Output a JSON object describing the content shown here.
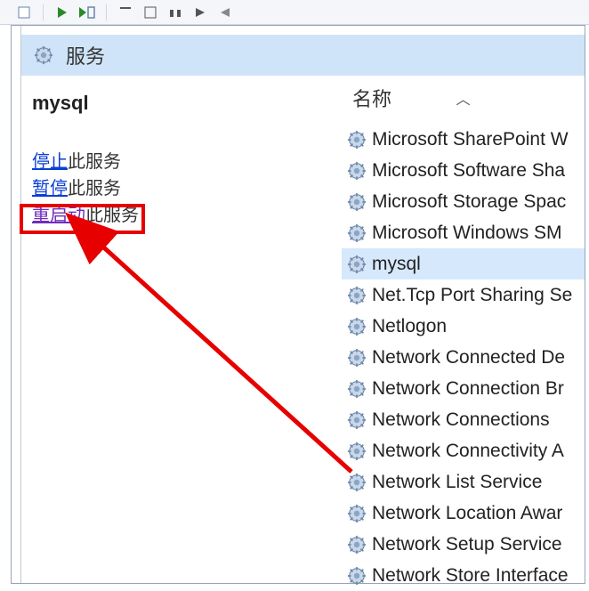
{
  "toolbar": {},
  "header": {
    "title": "服务"
  },
  "service_panel": {
    "selected_name": "mysql",
    "actions": {
      "stop_link": "停止",
      "stop_tail": "此服务",
      "pause_link": "暂停",
      "pause_tail": "此服务",
      "restart_link": "重启动",
      "restart_tail": "此服务"
    }
  },
  "list": {
    "column_label": "名称",
    "selected_index": 4,
    "items": [
      "Microsoft SharePoint W",
      "Microsoft Software Sha",
      "Microsoft Storage Spac",
      "Microsoft Windows SM",
      "mysql",
      "Net.Tcp Port Sharing Se",
      "Netlogon",
      "Network Connected De",
      "Network Connection Br",
      "Network Connections",
      "Network Connectivity A",
      "Network List Service",
      "Network Location Awar",
      "Network Setup Service",
      "Network Store Interface"
    ]
  }
}
